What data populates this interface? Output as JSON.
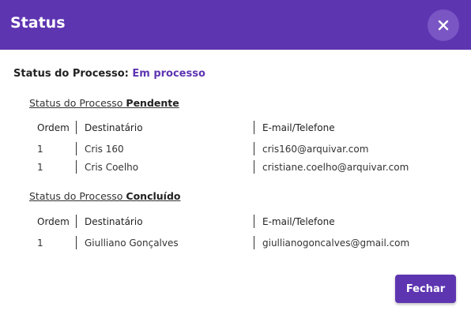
{
  "dialog": {
    "title": "Status",
    "close_icon": "close-icon",
    "status_label": "Status do Processo:",
    "status_value": "Em processo",
    "close_button_label": "Fechar"
  },
  "sections": [
    {
      "title_prefix": "Status do Processo",
      "title_status": "Pendente",
      "columns": [
        "Ordem",
        "Destinatário",
        "E-mail/Telefone"
      ],
      "rows": [
        {
          "ordem": "1",
          "destinatario": "Cris 160",
          "contato": "cris160@arquivar.com"
        },
        {
          "ordem": "1",
          "destinatario": "Cris Coelho",
          "contato": "cristiane.coelho@arquivar.com"
        }
      ]
    },
    {
      "title_prefix": "Status do Processo",
      "title_status": "Concluído",
      "columns": [
        "Ordem",
        "Destinatário",
        "E-mail/Telefone"
      ],
      "rows": [
        {
          "ordem": "1",
          "destinatario": "Giulliano Gonçalves",
          "contato": "giullianogoncalves@gmail.com"
        }
      ]
    }
  ],
  "colors": {
    "accent": "#5e35b1",
    "close_circle": "#7a56c4"
  }
}
